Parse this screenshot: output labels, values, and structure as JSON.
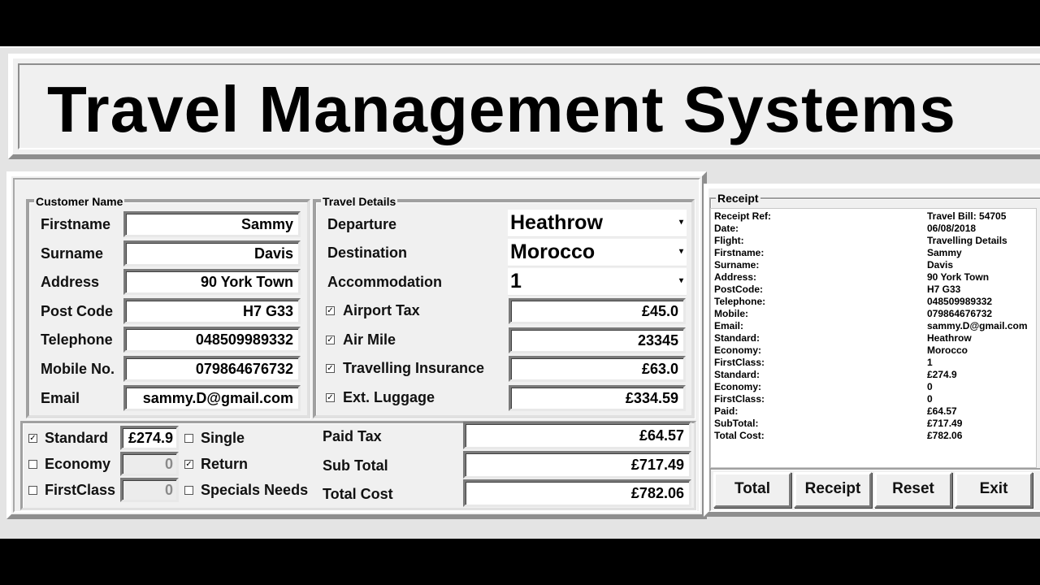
{
  "title": "Travel Management Systems",
  "customer": {
    "legend": "Customer Name",
    "fields": [
      {
        "label": "Firstname",
        "value": "Sammy"
      },
      {
        "label": "Surname",
        "value": "Davis"
      },
      {
        "label": "Address",
        "value": "90 York Town"
      },
      {
        "label": "Post Code",
        "value": "H7 G33"
      },
      {
        "label": "Telephone",
        "value": "048509989332"
      },
      {
        "label": "Mobile No.",
        "value": "079864676732"
      },
      {
        "label": "Email",
        "value": "sammy.D@gmail.com"
      }
    ]
  },
  "travel": {
    "legend": "Travel Details",
    "departure": {
      "label": "Departure",
      "value": "Heathrow"
    },
    "destination": {
      "label": "Destination",
      "value": "Morocco"
    },
    "accommodation": {
      "label": "Accommodation",
      "value": "1"
    },
    "checks": [
      {
        "label": "Airport Tax",
        "checked": true,
        "value": "£45.0"
      },
      {
        "label": "Air  Mile",
        "checked": true,
        "value": "23345"
      },
      {
        "label": "Travelling Insurance",
        "checked": true,
        "value": "£63.0"
      },
      {
        "label": "Ext. Luggage",
        "checked": true,
        "value": "£334.59"
      }
    ]
  },
  "classes": [
    {
      "label": "Standard",
      "checked": true,
      "value": "£274.9"
    },
    {
      "label": "Economy",
      "checked": false,
      "value": "0"
    },
    {
      "label": "FirstClass",
      "checked": false,
      "value": "0"
    }
  ],
  "options": [
    {
      "label": "Single",
      "checked": false
    },
    {
      "label": "Return",
      "checked": true
    },
    {
      "label": "Specials Needs",
      "checked": false
    }
  ],
  "totals": {
    "paid_tax": {
      "label": "Paid Tax",
      "value": "£64.57"
    },
    "sub_total": {
      "label": "Sub Total",
      "value": "£717.49"
    },
    "total_cost": {
      "label": "Total Cost",
      "value": "£782.06"
    }
  },
  "receipt": {
    "legend": "Receipt",
    "rows": [
      {
        "k": "Receipt Ref:",
        "v": "Travel Bill: 54705"
      },
      {
        "k": "Date:",
        "v": "06/08/2018"
      },
      {
        "k": "Flight:",
        "v": "Travelling Details"
      },
      {
        "k": "Firstname:",
        "v": "Sammy"
      },
      {
        "k": "Surname:",
        "v": "Davis"
      },
      {
        "k": "Address:",
        "v": "90 York Town"
      },
      {
        "k": "PostCode:",
        "v": "H7 G33"
      },
      {
        "k": "Telephone:",
        "v": "048509989332"
      },
      {
        "k": "Mobile:",
        "v": "079864676732"
      },
      {
        "k": "Email:",
        "v": "sammy.D@gmail.com"
      },
      {
        "k": "Standard:",
        "v": "Heathrow"
      },
      {
        "k": "Economy:",
        "v": "Morocco"
      },
      {
        "k": "FirstClass:",
        "v": "1"
      },
      {
        "k": "Standard:",
        "v": "£274.9"
      },
      {
        "k": "Economy:",
        "v": "0"
      },
      {
        "k": "FirstClass:",
        "v": "0"
      },
      {
        "k": "Paid:",
        "v": "£64.57"
      },
      {
        "k": "SubTotal:",
        "v": "£717.49"
      },
      {
        "k": "Total Cost:",
        "v": "£782.06"
      }
    ]
  },
  "buttons": {
    "total": "Total",
    "receipt": "Receipt",
    "reset": "Reset",
    "exit": "Exit"
  },
  "icons": {
    "checkmark": "✓",
    "dropdown": "▾"
  }
}
